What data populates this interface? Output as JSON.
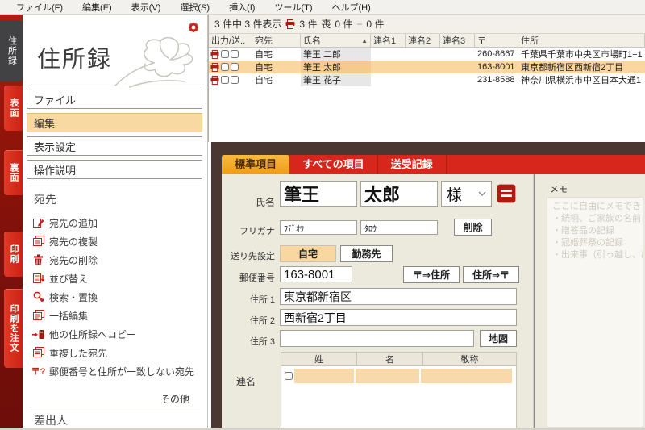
{
  "menu": {
    "items": [
      "ファイル(F)",
      "編集(E)",
      "表示(V)",
      "選択(S)",
      "挿入(I)",
      "ツール(T)",
      "ヘルプ(H)"
    ]
  },
  "side_tabs": {
    "book": "住所録",
    "front": "表面",
    "back": "裏面",
    "print": "印刷",
    "order_print": "印刷を注文"
  },
  "sidebar": {
    "title": "住所録",
    "nav": [
      "ファイル",
      "編集",
      "表示設定",
      "操作説明"
    ],
    "section_recipient": "宛先",
    "actions": [
      "宛先の追加",
      "宛先の複製",
      "宛先の削除",
      "並び替え",
      "検索・置換",
      "一括編集",
      "他の住所録へコピー",
      "重複した宛先",
      "郵便番号と住所が一致しない宛先"
    ],
    "postal_icon_text": "〒?",
    "more_link": "その他",
    "section_sender": "差出人"
  },
  "list": {
    "status": {
      "shown": "3 件中 3 件表示",
      "print_count": "3 件",
      "mourning_label": "喪",
      "mourning_count": "0 件",
      "minus_glyph": "−",
      "minus_count": "0 件"
    },
    "columns": [
      "出力/送..",
      "宛先",
      "氏名",
      "連名1",
      "連名2",
      "連名3",
      "〒",
      "住所"
    ],
    "sort_indicator": "▲",
    "rows": [
      {
        "type": "自宅",
        "name": "筆王 二郎",
        "zip": "260-8667",
        "address": "千葉県千葉市中央区市場町1−1"
      },
      {
        "type": "自宅",
        "name": "筆王 太郎",
        "zip": "163-8001",
        "address": "東京都新宿区西新宿2丁目"
      },
      {
        "type": "自宅",
        "name": "筆王 花子",
        "zip": "231-8588",
        "address": "神奈川県横浜市中区日本大通1"
      }
    ]
  },
  "detail": {
    "tabs": [
      "標準項目",
      "すべての項目",
      "送受記録"
    ],
    "form": {
      "name_label": "氏名",
      "last_name": "筆王",
      "first_name": "太郎",
      "honorific": "様",
      "kana_label": "フリガナ",
      "kana_last": "ﾌﾃﾞｵｳ",
      "kana_first": "ﾀﾛｳ",
      "delete_button": "削除",
      "dest_label": "送り先設定",
      "dest_home": "自宅",
      "dest_work": "勤務先",
      "zip_label": "郵便番号",
      "zip_value": "163-8001",
      "zip_to_addr_button": "〒⇒住所",
      "addr_to_zip_button": "住所⇒〒",
      "addr1_label": "住所 1",
      "addr1_value": "東京都新宿区",
      "addr2_label": "住所 2",
      "addr2_value": "西新宿2丁目",
      "addr3_label": "住所 3",
      "addr3_value": "",
      "map_button": "地図",
      "joint_label": "連名",
      "joint_columns": [
        "姓",
        "名",
        "敬称"
      ]
    },
    "memo": {
      "label": "メモ",
      "placeholder_lines": [
        "ここに自由にメモできます",
        "・続柄、ご家族の名前",
        "・贈答品の記録",
        "・冠婚葬祭の記録",
        "・出来事（引っ越し、出"
      ]
    }
  },
  "colors": {
    "accent_red": "#d7271c",
    "icon_red": "#c0241a",
    "dark_brown": "#4a3731",
    "selected_orange": "#f8d9a2",
    "tab_orange": "#f5a81e",
    "beige": "#ece9dd"
  }
}
